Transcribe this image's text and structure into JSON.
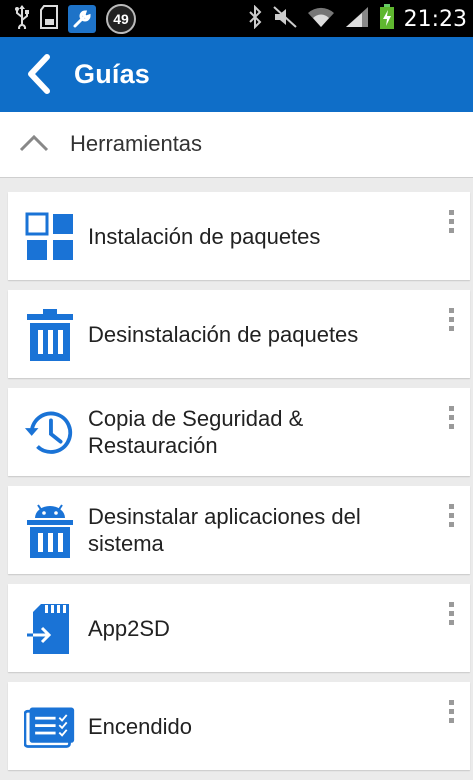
{
  "status_bar": {
    "notification_badge": "49",
    "time": "21:23",
    "icons": [
      "usb-icon",
      "sd-card-icon",
      "wrench-icon",
      "bluetooth-icon",
      "mute-icon",
      "wifi-icon",
      "signal-icon",
      "battery-charging-icon"
    ]
  },
  "app_bar": {
    "title": "Guías",
    "back_icon": "back-arrow-icon"
  },
  "section": {
    "title": "Herramientas",
    "icon": "chevron-up-icon"
  },
  "items": [
    {
      "label": "Instalación de paquetes",
      "icon": "grid-icon"
    },
    {
      "label": "Desinstalación de paquetes",
      "icon": "trash-icon"
    },
    {
      "label": "Copia de Seguridad & Restauración",
      "icon": "history-icon"
    },
    {
      "label": "Desinstalar aplicaciones del sistema",
      "icon": "android-trash-icon"
    },
    {
      "label": "App2SD",
      "icon": "sd-card-move-icon"
    },
    {
      "label": "Encendido",
      "icon": "power-list-icon"
    }
  ],
  "colors": {
    "primary": "#0f6ec8",
    "icon_blue": "#1a73d6",
    "background": "#ebebeb"
  }
}
